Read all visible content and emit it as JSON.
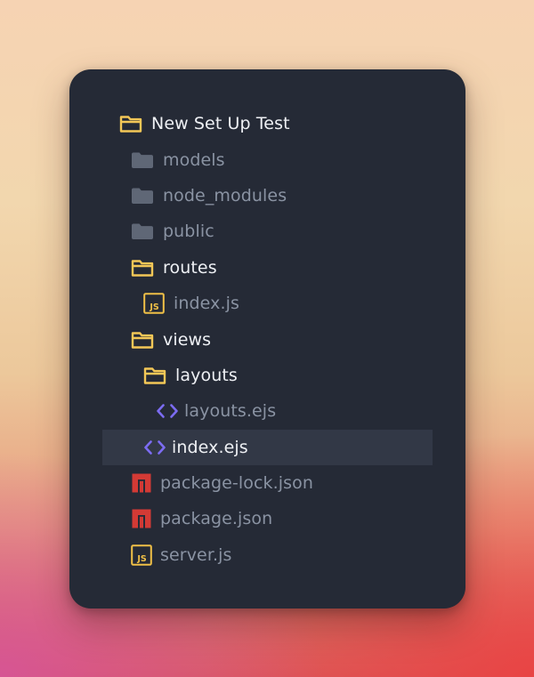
{
  "colors": {
    "panel_bg": "#252a36",
    "selected_bg": "#323846",
    "folder_open": "#f3c757",
    "folder_closed": "#5f6776",
    "js_icon": "#f0c047",
    "ejs_icon": "#7c6cf2",
    "npm_icon": "#d33a35",
    "text_bright": "#eef0f4",
    "text_dim": "#8a93a3"
  },
  "tree": {
    "items": [
      {
        "label": "New Set Up Test",
        "icon": "folder-open-icon"
      },
      {
        "label": "models",
        "icon": "folder-closed-icon"
      },
      {
        "label": "node_modules",
        "icon": "folder-closed-icon"
      },
      {
        "label": "public",
        "icon": "folder-closed-icon"
      },
      {
        "label": "routes",
        "icon": "folder-open-icon"
      },
      {
        "label": "index.js",
        "icon": "js-file-icon"
      },
      {
        "label": "views",
        "icon": "folder-open-icon"
      },
      {
        "label": "layouts",
        "icon": "folder-open-icon"
      },
      {
        "label": "layouts.ejs",
        "icon": "ejs-file-icon"
      },
      {
        "label": "index.ejs",
        "icon": "ejs-file-icon",
        "selected": true
      },
      {
        "label": "package-lock.json",
        "icon": "npm-file-icon"
      },
      {
        "label": "package.json",
        "icon": "npm-file-icon"
      },
      {
        "label": "server.js",
        "icon": "js-file-icon"
      }
    ]
  }
}
